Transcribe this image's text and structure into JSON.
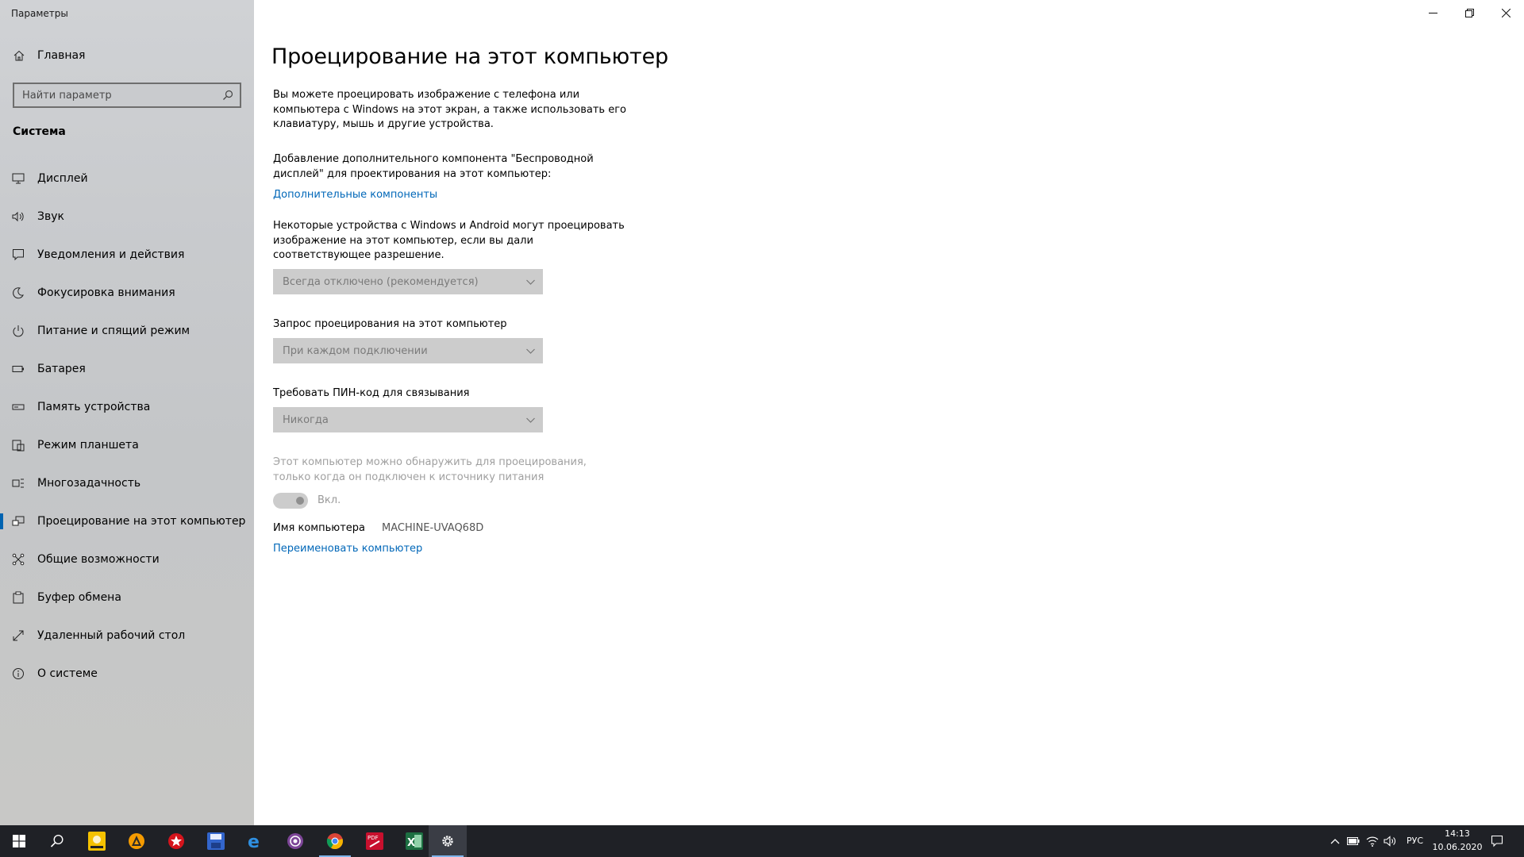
{
  "window": {
    "title": "Параметры"
  },
  "sidebar": {
    "home_label": "Главная",
    "search_placeholder": "Найти параметр",
    "section_title": "Система",
    "items": [
      {
        "label": "Дисплей",
        "icon": "display-icon"
      },
      {
        "label": "Звук",
        "icon": "sound-icon"
      },
      {
        "label": "Уведомления и действия",
        "icon": "notifications-icon"
      },
      {
        "label": "Фокусировка внимания",
        "icon": "focus-assist-icon"
      },
      {
        "label": "Питание и спящий режим",
        "icon": "power-icon"
      },
      {
        "label": "Батарея",
        "icon": "battery-icon"
      },
      {
        "label": "Память устройства",
        "icon": "storage-icon"
      },
      {
        "label": "Режим планшета",
        "icon": "tablet-mode-icon"
      },
      {
        "label": "Многозадачность",
        "icon": "multitasking-icon"
      },
      {
        "label": "Проецирование на этот компьютер",
        "icon": "projecting-icon",
        "active": true
      },
      {
        "label": "Общие возможности",
        "icon": "shared-experiences-icon"
      },
      {
        "label": "Буфер обмена",
        "icon": "clipboard-icon"
      },
      {
        "label": "Удаленный рабочий стол",
        "icon": "remote-desktop-icon"
      },
      {
        "label": "О системе",
        "icon": "about-icon"
      }
    ]
  },
  "main": {
    "title": "Проецирование на этот компьютер",
    "intro": "Вы можете проецировать изображение с телефона или компьютера с Windows на этот экран, а также использовать его клавиатуру, мышь и другие устройства.",
    "addon_text": "Добавление дополнительного компонента \"Беспроводной дисплей\" для проектирования на этот компьютер:",
    "addon_link": "Дополнительные компоненты",
    "permission_text": "Некоторые устройства с Windows и Android могут проецировать изображение на этот компьютер, если вы дали соответствующее разрешение.",
    "permission_value": "Всегда отключено (рекомендуется)",
    "request_label": "Запрос проецирования на этот компьютер",
    "request_value": "При каждом подключении",
    "pin_label": "Требовать ПИН-код для связывания",
    "pin_value": "Никогда",
    "power_text": "Этот компьютер можно обнаружить для проецирования, только когда он подключен к источнику питания",
    "toggle_label": "Вкл.",
    "toggle_on": true,
    "pc_name_label": "Имя компьютера",
    "pc_name_value": "MACHINE-UVAQ68D",
    "rename_link": "Переименовать компьютер"
  },
  "taskbar": {
    "apps": [
      "start-icon",
      "search-icon",
      "player-icon",
      "aimp-icon",
      "star-app-icon",
      "save-app-icon",
      "edge-icon",
      "tor-icon",
      "chrome-icon",
      "pdf-icon",
      "excel-icon",
      "settings-icon"
    ],
    "language": "РУС",
    "time": "14:13",
    "date": "10.06.2020"
  },
  "colors": {
    "accent": "#0063b1",
    "link": "#0067b8",
    "taskbar": "#1f2126"
  }
}
